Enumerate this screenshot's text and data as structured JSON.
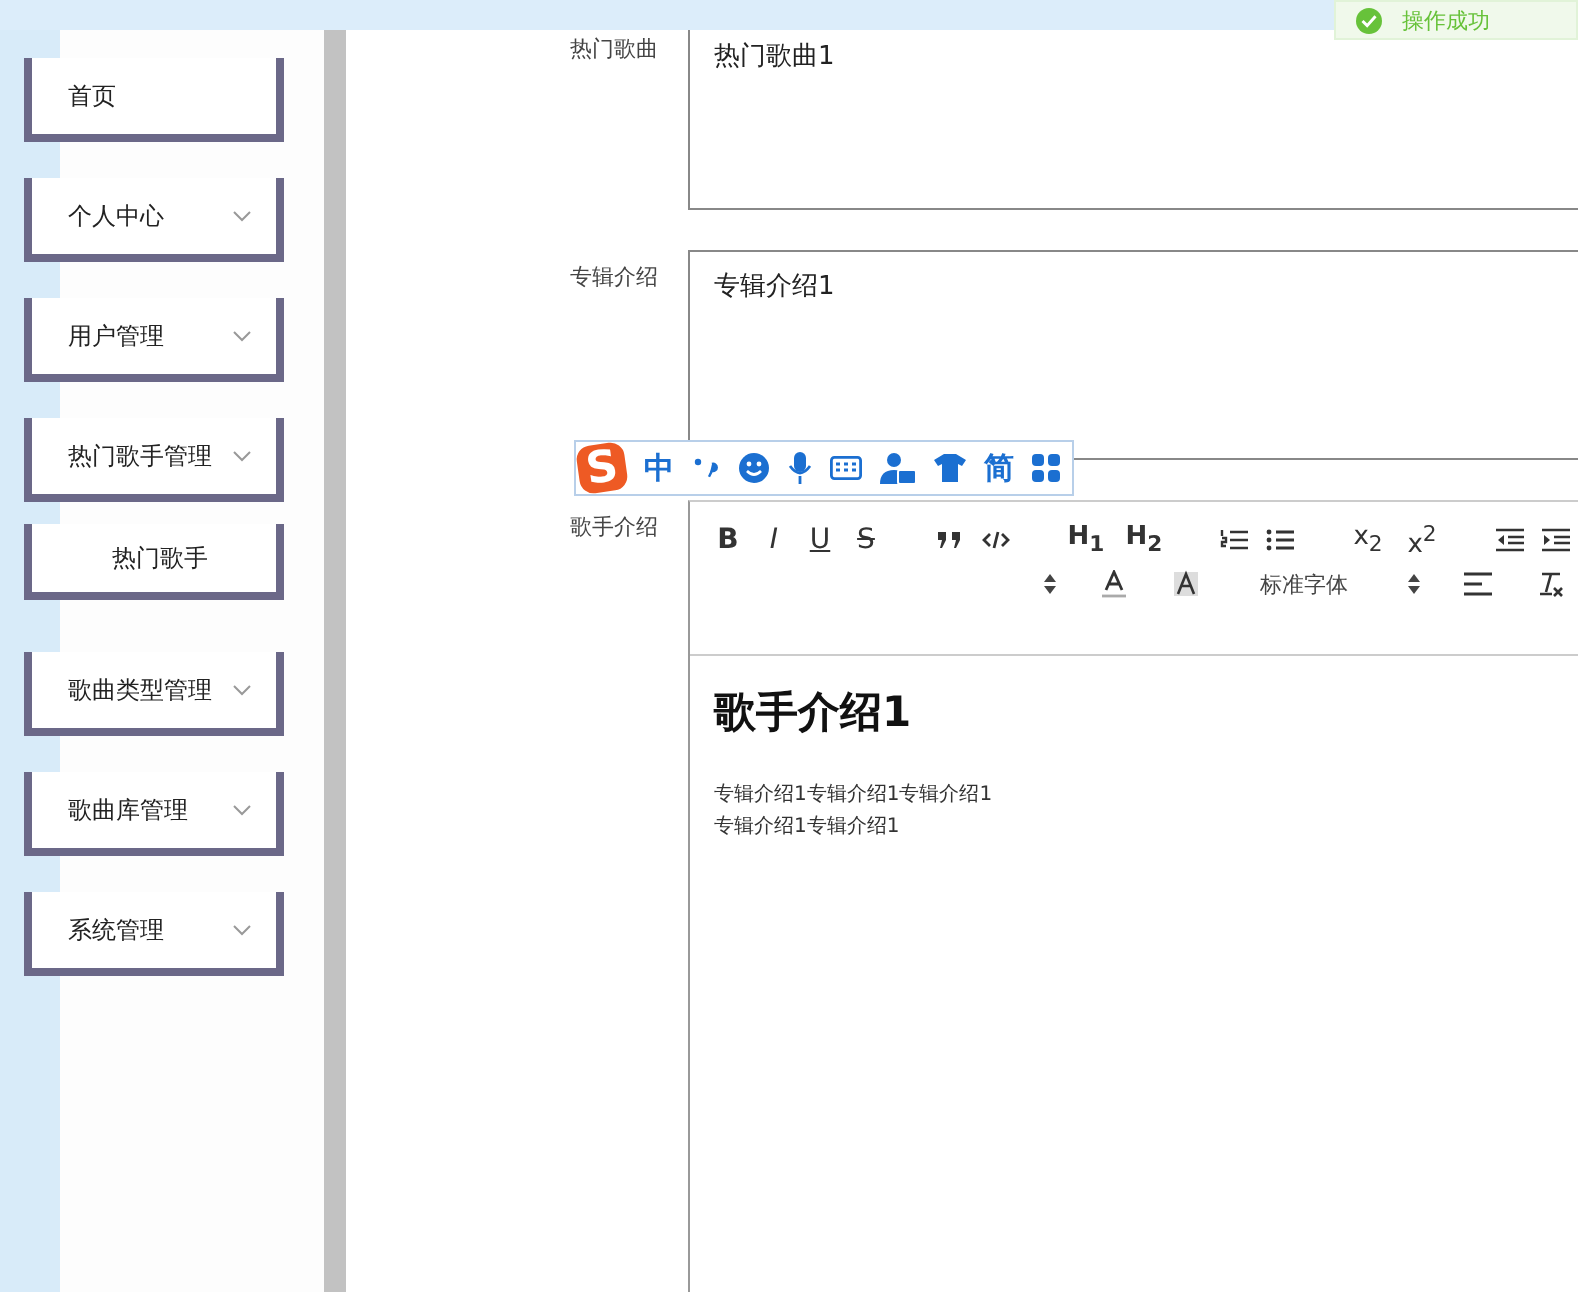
{
  "sidebar": {
    "items": [
      {
        "label": "首页",
        "has_submenu": false
      },
      {
        "label": "个人中心",
        "has_submenu": true
      },
      {
        "label": "用户管理",
        "has_submenu": true
      },
      {
        "label": "热门歌手管理",
        "has_submenu": true,
        "children": [
          {
            "label": "热门歌手"
          }
        ]
      },
      {
        "label": "歌曲类型管理",
        "has_submenu": true
      },
      {
        "label": "歌曲库管理",
        "has_submenu": true
      },
      {
        "label": "系统管理",
        "has_submenu": true
      }
    ]
  },
  "toast": {
    "text": "操作成功"
  },
  "form": {
    "fields": [
      {
        "kind": "textarea",
        "label": "热门歌曲",
        "value": "热门歌曲1"
      },
      {
        "kind": "textarea",
        "label": "专辑介绍",
        "value": "专辑介绍1"
      },
      {
        "kind": "editor",
        "label": "歌手介绍",
        "heading": "歌手介绍1",
        "paragraphs": [
          "专辑介绍1专辑介绍1专辑介绍1",
          "专辑介绍1专辑介绍1"
        ]
      }
    ]
  },
  "editor_toolbar": {
    "text_buttons": [
      "B",
      "I",
      "U",
      "S",
      "H$_{1}$",
      "H$_{2}$",
      "x$_{2}$",
      "x$^{2}$"
    ],
    "font_select": "标准字体"
  },
  "ime_bar": {
    "logo": "S",
    "mode": "中",
    "script": "简"
  }
}
